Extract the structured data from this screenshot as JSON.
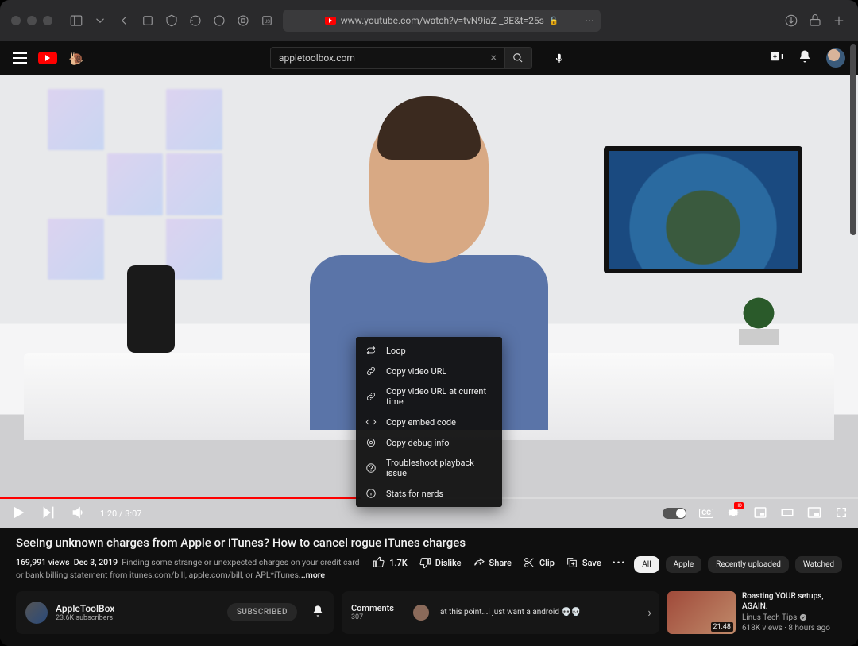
{
  "browser": {
    "url": "www.youtube.com/watch?v=tvN9iaZ-_3E&t=25s"
  },
  "header": {
    "search_value": "appletoolbox.com"
  },
  "player": {
    "time_current": "1:20",
    "time_total": "3:07",
    "hd_badge": "HD",
    "cc": "CC"
  },
  "context_menu": [
    "Loop",
    "Copy video URL",
    "Copy video URL at current time",
    "Copy embed code",
    "Copy debug info",
    "Troubleshoot playback issue",
    "Stats for nerds"
  ],
  "video": {
    "title": "Seeing unknown charges from Apple or iTunes? How to cancel rogue iTunes charges",
    "views": "169,991 views",
    "date": "Dec 3, 2019",
    "desc": "Finding some strange or unexpected charges on your credit card or bank billing statement from itunes.com/bill, apple.com/bill, or APL*iTunes",
    "more": "...more"
  },
  "actions": {
    "like": "1.7K",
    "dislike": "Dislike",
    "share": "Share",
    "clip": "Clip",
    "save": "Save"
  },
  "chips": [
    "All",
    "Apple",
    "Recently uploaded",
    "Watched"
  ],
  "channel": {
    "name": "AppleToolBox",
    "subs": "23.6K subscribers",
    "button": "SUBSCRIBED"
  },
  "comments": {
    "header": "Comments",
    "count": "307",
    "top": "at this point...i just want a android 💀💀"
  },
  "recommendation": {
    "title": "Roasting YOUR setups, AGAIN.",
    "channel": "Linus Tech Tips",
    "stats": "618K views · 8 hours ago",
    "duration": "21:48"
  }
}
